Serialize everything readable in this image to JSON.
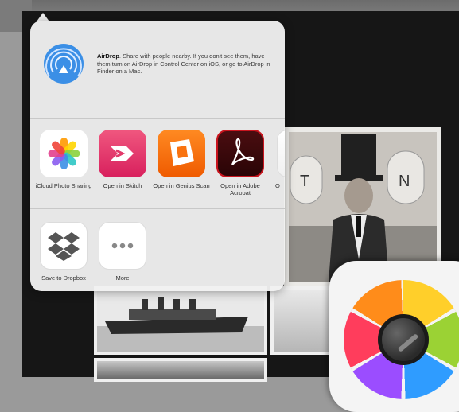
{
  "share_sheet": {
    "airdrop": {
      "icon": "airdrop-icon",
      "title": "AirDrop",
      "description": ". Share with people nearby. If you don't see them, have them turn on AirDrop in Control Center on iOS, or go to AirDrop in Finder on a Mac."
    },
    "apps": [
      {
        "label": "iCloud Photo Sharing",
        "icon": "photos-icon"
      },
      {
        "label": "Open in Skitch",
        "icon": "skitch-icon"
      },
      {
        "label": "Open in Genius Scan",
        "icon": "genius-scan-icon"
      },
      {
        "label": "Open in Adobe Acrobat",
        "icon": "acrobat-icon"
      },
      {
        "label": "O",
        "icon": "partial-app-icon"
      }
    ],
    "actions": [
      {
        "label": "Save to Dropbox",
        "icon": "dropbox-icon"
      },
      {
        "label": "More",
        "icon": "more-dots-icon"
      }
    ]
  },
  "background": {
    "photo_sign_letter_left": "T",
    "photo_sign_letter_right": "N"
  },
  "colors": {
    "sheet_background": "#f0f0f0",
    "airdrop_blue": "#3b8fe6",
    "skitch_pink": "#e23a6b",
    "genius_orange": "#f97310",
    "acrobat_red": "#c9141e"
  }
}
